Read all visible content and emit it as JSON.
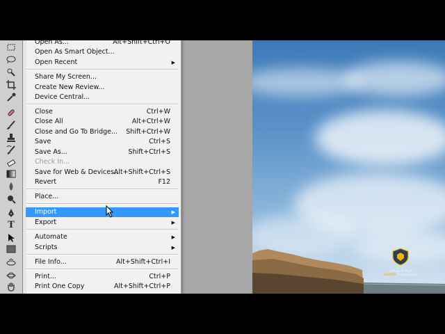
{
  "file_menu": {
    "items": [
      {
        "label": "Open As...",
        "shortcut": "Alt+Shift+Ctrl+O"
      },
      {
        "label": "Open As Smart Object..."
      },
      {
        "label": "Open Recent",
        "submenu": true
      },
      {
        "label": "Share My Screen..."
      },
      {
        "label": "Create New Review..."
      },
      {
        "label": "Device Central..."
      },
      {
        "label": "Close",
        "shortcut": "Ctrl+W"
      },
      {
        "label": "Close All",
        "shortcut": "Alt+Ctrl+W"
      },
      {
        "label": "Close and Go To Bridge...",
        "shortcut": "Shift+Ctrl+W"
      },
      {
        "label": "Save",
        "shortcut": "Ctrl+S"
      },
      {
        "label": "Save As...",
        "shortcut": "Shift+Ctrl+S"
      },
      {
        "label": "Check In...",
        "disabled": true
      },
      {
        "label": "Save for Web & Devices...",
        "shortcut": "Alt+Shift+Ctrl+S"
      },
      {
        "label": "Revert",
        "shortcut": "F12"
      },
      {
        "label": "Place..."
      },
      {
        "label": "Import",
        "submenu": true,
        "highlighted": true
      },
      {
        "label": "Export",
        "submenu": true
      },
      {
        "label": "Automate",
        "submenu": true
      },
      {
        "label": "Scripts",
        "submenu": true
      },
      {
        "label": "File Info...",
        "shortcut": "Alt+Shift+Ctrl+I"
      },
      {
        "label": "Print...",
        "shortcut": "Ctrl+P"
      },
      {
        "label": "Print One Copy",
        "shortcut": "Alt+Shift+Ctrl+P"
      }
    ],
    "submenu_arrow": "▶",
    "highlight_color": "#3399ff"
  },
  "watermark": {
    "line1": "مرکز آموزشی",
    "line2_prefix": "",
    "line2_gold": "SHAHRD",
    "line2_suffix": " Training Center",
    "accent_color": "#f2b400"
  },
  "toolbar_icons": [
    "marquee-icon",
    "lasso-icon",
    "quick-selection-icon",
    "crop-icon",
    "eyedropper-icon",
    "healing-brush-icon",
    "brush-icon",
    "clone-stamp-icon",
    "history-brush-icon",
    "eraser-icon",
    "gradient-icon",
    "blur-icon",
    "dodge-icon",
    "pen-icon",
    "type-icon",
    "path-selection-icon",
    "shape-icon",
    "3d-rotate-icon",
    "3d-orbit-icon",
    "hand-icon"
  ]
}
